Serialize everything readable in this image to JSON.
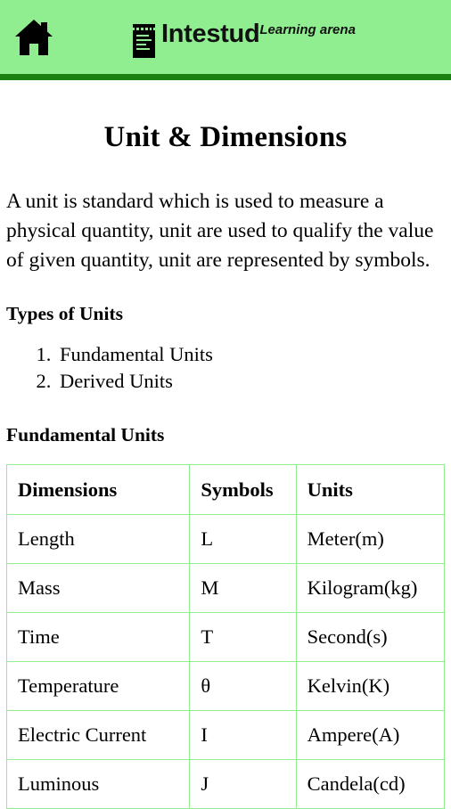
{
  "header": {
    "home_icon": "home-icon",
    "brand_icon": "notepad-icon",
    "brand_name": "Intestud",
    "brand_tagline": "Learning arena",
    "background_color": "#90ee90",
    "rule_color": "#1a8011"
  },
  "article": {
    "title": "Unit & Dimensions",
    "intro": "A unit is standard which is used to measure a physical quantity, unit are used to qualify the value of given quantity, unit are represented by symbols.",
    "types_heading": "Types of Units",
    "types": [
      "Fundamental Units",
      "Derived Units"
    ],
    "fundamental_heading": "Fundamental Units",
    "table": {
      "border_color": "#90ee90",
      "columns": [
        "Dimensions",
        "Symbols",
        "Units"
      ],
      "rows": [
        [
          "Length",
          "L",
          "Meter(m)"
        ],
        [
          "Mass",
          "M",
          "Kilogram(kg)"
        ],
        [
          "Time",
          "T",
          "Second(s)"
        ],
        [
          "Temperature",
          "θ",
          "Kelvin(K)"
        ],
        [
          "Electric Current",
          "I",
          "Ampere(A)"
        ],
        [
          "Luminous",
          "J",
          "Candela(cd)"
        ]
      ]
    }
  }
}
